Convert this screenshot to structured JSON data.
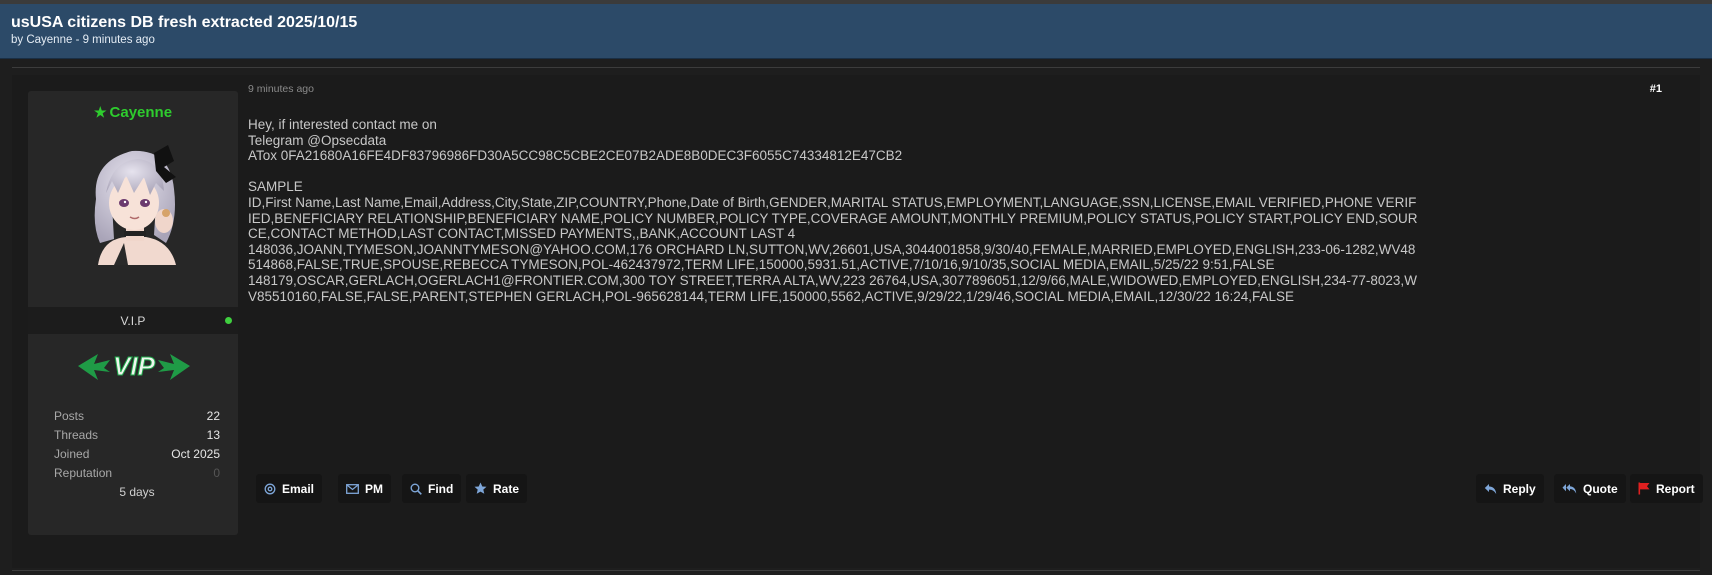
{
  "thread": {
    "title": "usUSA citizens DB fresh extracted 2025/10/15",
    "byline": "by Cayenne - 9 minutes ago"
  },
  "user": {
    "name": "Cayenne",
    "rank": "V.I.P",
    "badge_text": "VIP",
    "stats": [
      {
        "label": "Posts",
        "value": "22"
      },
      {
        "label": "Threads",
        "value": "13"
      },
      {
        "label": "Joined",
        "value": "Oct 2025"
      },
      {
        "label": "Reputation",
        "value": "0"
      }
    ],
    "online_time": "5 days"
  },
  "post": {
    "time": "9 minutes ago",
    "number": "#1",
    "lines": [
      "Hey, if interested contact me on",
      "Telegram @Opsecdata",
      "ATox 0FA21680A16FE4DF83796986FD30A5CC98C5CBE2CE07B2ADE8B0DEC3F6055C74334812E47CB2",
      "",
      "SAMPLE",
      "ID,First Name,Last Name,Email,Address,City,State,ZIP,COUNTRY,Phone,Date of Birth,GENDER,MARITAL STATUS,EMPLOYMENT,LANGUAGE,SSN,LICENSE,EMAIL VERIFIED,PHONE VERIFIED,BENEFICIARY RELATIONSHIP,BENEFICIARY NAME,POLICY NUMBER,POLICY TYPE,COVERAGE AMOUNT,MONTHLY PREMIUM,POLICY STATUS,POLICY START,POLICY END,SOURCE,CONTACT METHOD,LAST CONTACT,MISSED PAYMENTS,,BANK,ACCOUNT LAST 4",
      "148036,JOANN,TYMESON,JOANNTYMESON@YAHOO.COM,176 ORCHARD LN,SUTTON,WV,26601,USA,3044001858,9/30/40,FEMALE,MARRIED,EMPLOYED,ENGLISH,233-06-1282,WV48514868,FALSE,TRUE,SPOUSE,REBECCA TYMESON,POL-462437972,TERM LIFE,150000,5931.51,ACTIVE,7/10/16,9/10/35,SOCIAL MEDIA,EMAIL,5/25/22 9:51,FALSE",
      "148179,OSCAR,GERLACH,OGERLACH1@FRONTIER.COM,300 TOY STREET,TERRA ALTA,WV,223 26764,USA,3077896051,12/9/66,MALE,WIDOWED,EMPLOYED,ENGLISH,234-77-8023,WV85510160,FALSE,FALSE,PARENT,STEPHEN GERLACH,POL-965628144,TERM LIFE,150000,5562,ACTIVE,9/29/22,1/29/46,SOCIAL MEDIA,EMAIL,12/30/22 16:24,FALSE"
    ]
  },
  "actions": {
    "email": "Email",
    "pm": "PM",
    "find": "Find",
    "rate": "Rate",
    "reply": "Reply",
    "quote": "Quote",
    "report": "Report"
  },
  "colors": {
    "header_bg": "#2c4a68",
    "username": "#2ecc2e",
    "online_dot": "#3fcf3f",
    "report_flag": "#e02020",
    "icon_blue": "#7ea6d8"
  },
  "icons": [
    "star-icon",
    "online-dot-icon",
    "at-icon",
    "envelope-icon",
    "search-icon",
    "rate-star-icon",
    "reply-icon",
    "quote-icon",
    "flag-icon"
  ]
}
